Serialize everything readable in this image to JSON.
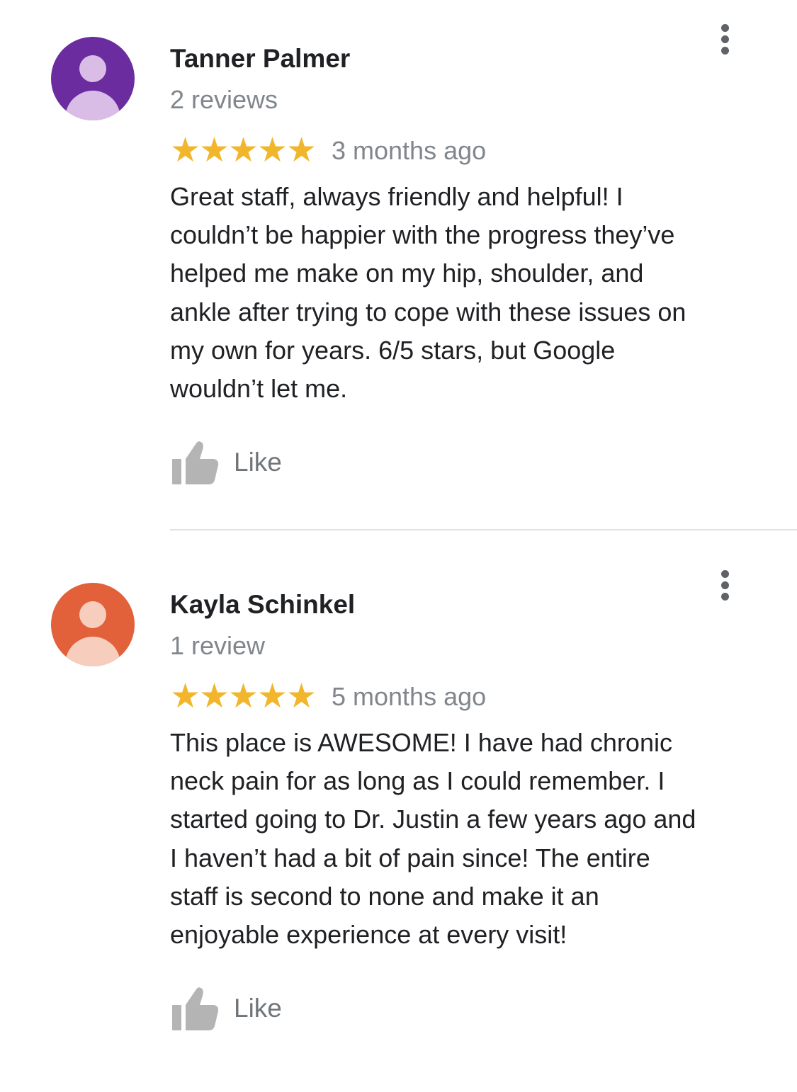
{
  "reviews": [
    {
      "name": "Tanner Palmer",
      "review_count": "2 reviews",
      "rating": 5,
      "rating_max": 5,
      "time_ago": "3 months ago",
      "text_lines": [
        "Great staff, always friendly and helpful! I",
        "couldn’t be happier with the progress they’ve",
        "helped me make on my hip, shoulder, and",
        "ankle after trying to cope with these issues on",
        "my own for years. 6/5 stars, but Google",
        "wouldn’t let me."
      ],
      "like_label": "Like",
      "avatar_color": "#6b2c9f",
      "avatar_fg": "#d9bde6",
      "avatar_icon": "person-icon"
    },
    {
      "name": "Kayla Schinkel",
      "review_count": "1 review",
      "rating": 5,
      "rating_max": 5,
      "time_ago": "5 months ago",
      "text_lines": [
        "This place is AWESOME! I have had chronic",
        "neck pain for as long as I could remember. I",
        "started going to Dr. Justin a few years ago and",
        "I haven’t had a bit of pain since! The entire",
        "staff is second to none and make it an",
        "enjoyable experience at every visit!"
      ],
      "like_label": "Like",
      "avatar_color": "#e2603a",
      "avatar_fg": "#f7cdbd",
      "avatar_icon": "person-icon"
    }
  ],
  "colors": {
    "star": "#f2b62c",
    "name": "#202124",
    "secondary": "#80868b",
    "like_icon": "#b4b4b4",
    "menu": "#5f6368"
  },
  "icons": {
    "like": "thumbs-up-icon",
    "menu": "more-vertical-icon",
    "star": "star-icon"
  }
}
